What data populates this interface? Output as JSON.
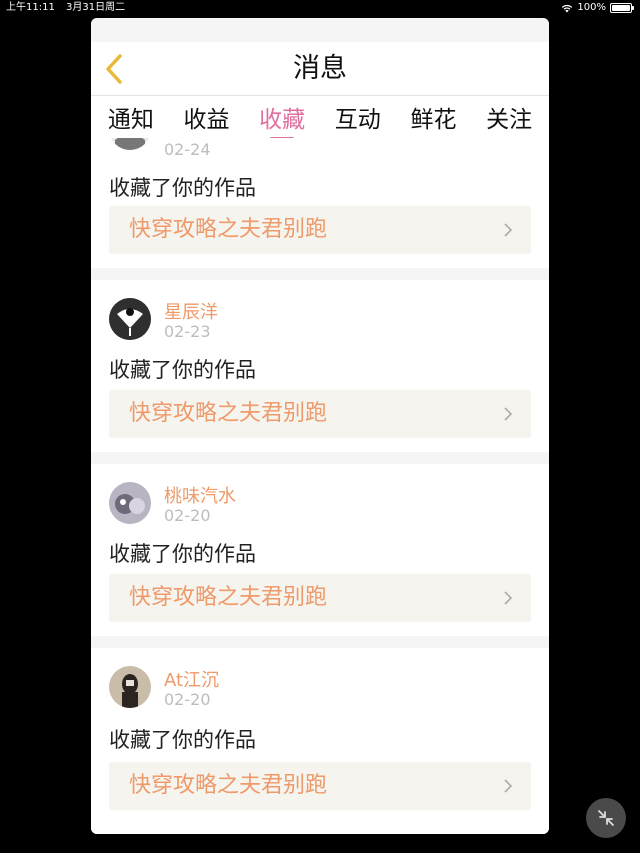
{
  "status_bar": {
    "time": "上午11:11",
    "date": "3月31日周二",
    "battery": "100%",
    "battery_level": 1.0
  },
  "header": {
    "title": "消息",
    "back_icon": "chevron-left-icon",
    "accent_color": "#e8b93a"
  },
  "tabs": [
    {
      "label": "通知",
      "active": false
    },
    {
      "label": "收益",
      "active": false
    },
    {
      "label": "收藏",
      "active": true
    },
    {
      "label": "互动",
      "active": false
    },
    {
      "label": "鲜花",
      "active": false
    },
    {
      "label": "关注",
      "active": false
    }
  ],
  "active_tab_color": "#e06fa0",
  "messages": [
    {
      "user": "",
      "date": "02-24",
      "action": "收藏了你的作品",
      "work_title": "快穿攻略之夫君别跑"
    },
    {
      "user": "星辰洋",
      "date": "02-23",
      "action": "收藏了你的作品",
      "work_title": "快穿攻略之夫君别跑"
    },
    {
      "user": "桃味汽水",
      "date": "02-20",
      "action": "收藏了你的作品",
      "work_title": "快穿攻略之夫君别跑"
    },
    {
      "user": "At江沉",
      "date": "02-20",
      "action": "收藏了你的作品",
      "work_title": "快穿攻略之夫君别跑"
    }
  ],
  "colors": {
    "name": "#ee9a6a",
    "date": "#bdbdbd",
    "work_bg": "#f5f4ee"
  },
  "fab_icon": "collapse-arrows-icon"
}
